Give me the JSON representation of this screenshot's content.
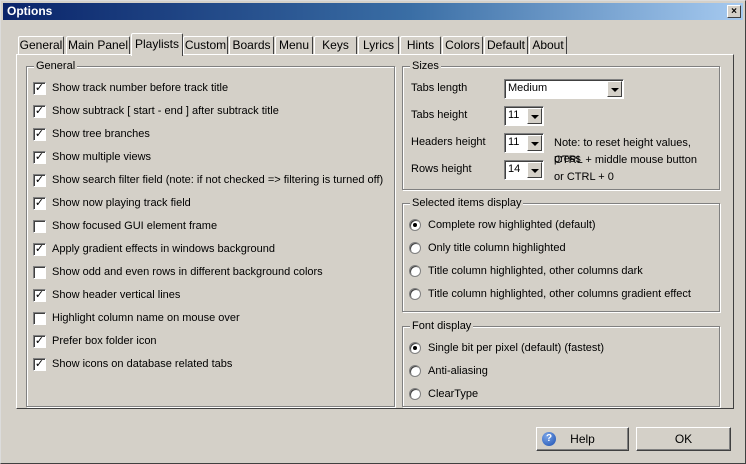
{
  "window": {
    "title": "Options",
    "close_glyph": "×"
  },
  "tabs": [
    {
      "label": "General"
    },
    {
      "label": "Main Panel"
    },
    {
      "label": "Playlists"
    },
    {
      "label": "Custom"
    },
    {
      "label": "Boards"
    },
    {
      "label": "Menu"
    },
    {
      "label": "Keys"
    },
    {
      "label": "Lyrics"
    },
    {
      "label": "Hints"
    },
    {
      "label": "Colors"
    },
    {
      "label": "Default"
    },
    {
      "label": "About"
    }
  ],
  "active_tab": "Playlists",
  "general": {
    "title": "General",
    "options": [
      {
        "label": "Show track number before track title",
        "checked": true
      },
      {
        "label": "Show subtrack [ start - end ] after subtrack title",
        "checked": true
      },
      {
        "label": "Show tree branches",
        "checked": true
      },
      {
        "label": "Show multiple views",
        "checked": true
      },
      {
        "label": "Show search filter field (note: if not checked => filtering is turned off)",
        "checked": true
      },
      {
        "label": "Show now playing track field",
        "checked": true
      },
      {
        "label": "Show focused GUI element frame",
        "checked": false
      },
      {
        "label": "Apply gradient effects in windows background",
        "checked": true
      },
      {
        "label": "Show odd and even rows in different background colors",
        "checked": false
      },
      {
        "label": "Show header vertical lines",
        "checked": true
      },
      {
        "label": "Highlight column name on mouse over",
        "checked": false
      },
      {
        "label": "Prefer box folder icon",
        "checked": true
      },
      {
        "label": "Show icons on database related tabs",
        "checked": true
      }
    ]
  },
  "sizes": {
    "title": "Sizes",
    "tabs_length_label": "Tabs length",
    "tabs_length_value": "Medium",
    "tabs_height_label": "Tabs height",
    "tabs_height_value": "11",
    "headers_height_label": "Headers height",
    "headers_height_value": "11",
    "rows_height_label": "Rows height",
    "rows_height_value": "14",
    "note_line1": "Note: to reset height values, press",
    "note_line2": "CTRL + middle mouse button",
    "note_line3": "or CTRL + 0"
  },
  "selected_items": {
    "title": "Selected items display",
    "options": [
      {
        "label": "Complete row highlighted (default)",
        "selected": true
      },
      {
        "label": "Only title column highlighted",
        "selected": false
      },
      {
        "label": "Title column highlighted, other columns dark",
        "selected": false
      },
      {
        "label": "Title column highlighted, other columns gradient effect",
        "selected": false
      }
    ]
  },
  "font_display": {
    "title": "Font display",
    "options": [
      {
        "label": "Single bit per pixel (default) (fastest)",
        "selected": true
      },
      {
        "label": "Anti-aliasing",
        "selected": false
      },
      {
        "label": "ClearType",
        "selected": false
      }
    ]
  },
  "buttons": {
    "help_label": "Help",
    "ok_label": "OK",
    "help_icon_glyph": "?"
  }
}
